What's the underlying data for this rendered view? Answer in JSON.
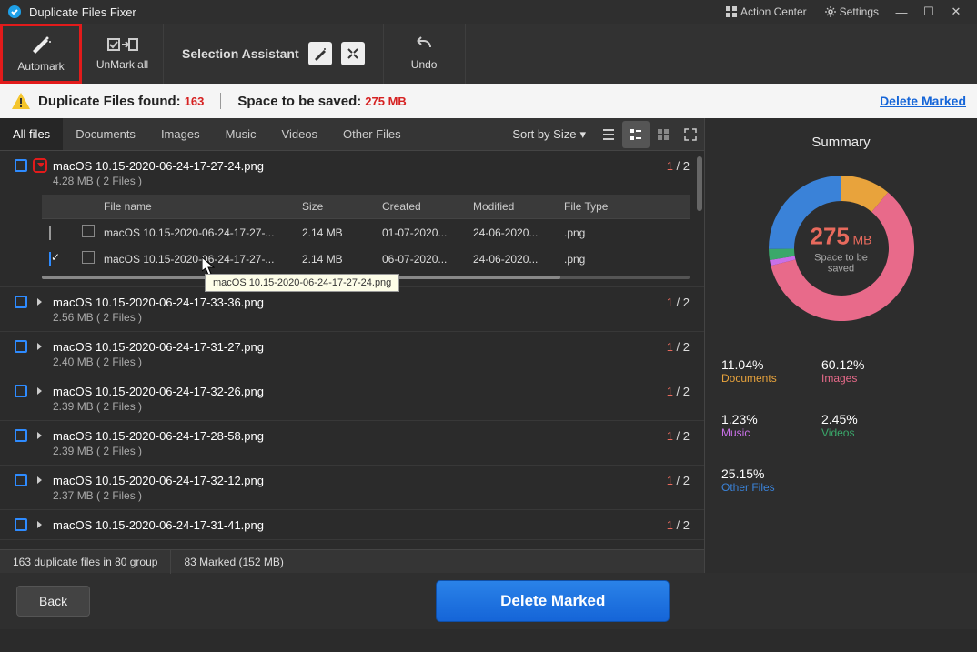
{
  "titlebar": {
    "app": "Duplicate Files Fixer",
    "action_center": "Action Center",
    "settings": "Settings"
  },
  "toolbar": {
    "automark": "Automark",
    "unmark": "UnMark all",
    "assistant": "Selection Assistant",
    "undo": "Undo"
  },
  "infobar": {
    "found_label": "Duplicate Files found:",
    "found_count": "163",
    "space_label": "Space to be saved:",
    "space_value": "275 MB",
    "delete_marked": "Delete Marked"
  },
  "tabs": {
    "all": "All files",
    "documents": "Documents",
    "images": "Images",
    "music": "Music",
    "videos": "Videos",
    "other": "Other Files",
    "sort": "Sort by Size"
  },
  "groups": [
    {
      "name": "macOS 10.15-2020-06-24-17-27-24.png",
      "size": "4.28 MB  ( 2 Files )",
      "marked": "1",
      "total": "2",
      "expanded": true,
      "highlight_expand": true,
      "files": [
        {
          "checked": false,
          "name": "macOS 10.15-2020-06-24-17-27-...",
          "size": "2.14 MB",
          "created": "01-07-2020...",
          "modified": "24-06-2020...",
          "type": ".png"
        },
        {
          "checked": true,
          "name": "macOS 10.15-2020-06-24-17-27-...",
          "size": "2.14 MB",
          "created": "06-07-2020...",
          "modified": "24-06-2020...",
          "type": ".png"
        }
      ]
    },
    {
      "name": "macOS 10.15-2020-06-24-17-33-36.png",
      "size": "2.56 MB  ( 2 Files )",
      "marked": "1",
      "total": "2"
    },
    {
      "name": "macOS 10.15-2020-06-24-17-31-27.png",
      "size": "2.40 MB  ( 2 Files )",
      "marked": "1",
      "total": "2"
    },
    {
      "name": "macOS 10.15-2020-06-24-17-32-26.png",
      "size": "2.39 MB  ( 2 Files )",
      "marked": "1",
      "total": "2"
    },
    {
      "name": "macOS 10.15-2020-06-24-17-28-58.png",
      "size": "2.39 MB  ( 2 Files )",
      "marked": "1",
      "total": "2"
    },
    {
      "name": "macOS 10.15-2020-06-24-17-32-12.png",
      "size": "2.37 MB  ( 2 Files )",
      "marked": "1",
      "total": "2"
    },
    {
      "name": "macOS 10.15-2020-06-24-17-31-41.png",
      "size": "",
      "marked": "1",
      "total": "2"
    }
  ],
  "headers": {
    "filename": "File name",
    "size": "Size",
    "created": "Created",
    "modified": "Modified",
    "filetype": "File Type"
  },
  "tooltip": "macOS 10.15-2020-06-24-17-27-24.png",
  "status": {
    "groups": "163 duplicate files in 80 group",
    "marked": "83 Marked (152 MB)"
  },
  "actions": {
    "back": "Back",
    "delete": "Delete Marked"
  },
  "summary": {
    "title": "Summary",
    "value": "275",
    "unit": "MB",
    "sub": "Space to be saved",
    "stats": [
      {
        "pct": "11.04%",
        "label": "Documents",
        "color": "#e8a33c"
      },
      {
        "pct": "60.12%",
        "label": "Images",
        "color": "#e86a8a"
      },
      {
        "pct": "1.23%",
        "label": "Music",
        "color": "#c970e8"
      },
      {
        "pct": "2.45%",
        "label": "Videos",
        "color": "#3aa86a"
      },
      {
        "pct": "25.15%",
        "label": "Other Files",
        "color": "#3a82d8"
      }
    ]
  },
  "chart_data": {
    "type": "pie",
    "title": "Space to be saved by category",
    "categories": [
      "Documents",
      "Images",
      "Music",
      "Videos",
      "Other Files"
    ],
    "values": [
      11.04,
      60.12,
      1.23,
      2.45,
      25.15
    ],
    "unit": "%",
    "total_label": "275 MB"
  }
}
